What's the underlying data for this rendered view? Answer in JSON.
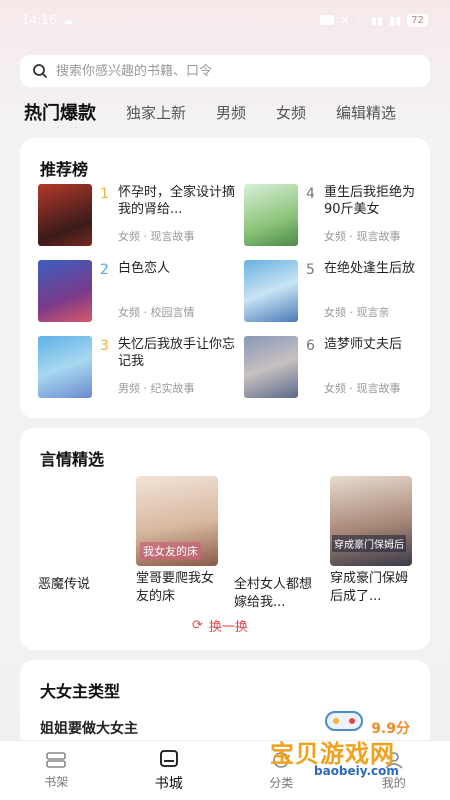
{
  "status": {
    "time": "14:16",
    "battery": "72"
  },
  "search": {
    "placeholder": "搜索你感兴趣的书籍、口令"
  },
  "tabs": [
    {
      "label": "热门爆款",
      "active": true
    },
    {
      "label": "独家上新"
    },
    {
      "label": "男频"
    },
    {
      "label": "女频"
    },
    {
      "label": "编辑精选"
    }
  ],
  "ranking": {
    "title": "推荐榜",
    "items": [
      {
        "num": "1",
        "title": "怀孕时，全家设计摘我的肾给...",
        "meta": "女频 · 现言故事",
        "num_color": "#f3b23a"
      },
      {
        "num": "2",
        "title": "白色恋人",
        "meta": "女频 · 校园言情",
        "num_color": "#5aa7e0"
      },
      {
        "num": "3",
        "title": "失忆后我放手让你忘记我",
        "meta": "男频 · 纪实故事",
        "num_color": "#f3b23a"
      },
      {
        "num": "4",
        "title": "重生后我拒绝为90斤美女",
        "meta": "女频 · 现言故事",
        "num_color": "#777777"
      },
      {
        "num": "5",
        "title": "在绝处逢生后放",
        "meta": "女频 · 现言亲",
        "num_color": "#777777"
      },
      {
        "num": "6",
        "title": "造梦师丈夫后",
        "meta": "女频 · 现言故事",
        "num_color": "#777777"
      }
    ]
  },
  "romance": {
    "title": "言情精选",
    "items": [
      {
        "title": "恶魔传说",
        "has_cover": false
      },
      {
        "title": "堂哥要爬我女友的床",
        "has_cover": true,
        "cover_text": "我女友的床"
      },
      {
        "title": "全村女人都想嫁给我...",
        "has_cover": false
      },
      {
        "title": "穿成豪门保姆后成了...",
        "has_cover": true,
        "cover_text": "穿成豪门保姆后"
      }
    ],
    "refresh_label": "换一换"
  },
  "heroine": {
    "title": "大女主类型",
    "first_item": "姐姐要做大女主",
    "score": "9.9分"
  },
  "nav": [
    {
      "label": "书架",
      "icon": "bookshelf-icon"
    },
    {
      "label": "书城",
      "icon": "bookstore-icon",
      "active": true
    },
    {
      "label": "分类",
      "icon": "category-icon"
    },
    {
      "label": "我的",
      "icon": "profile-icon"
    }
  ],
  "watermark": {
    "title": "宝贝游戏网",
    "url": "baobeiy.com"
  }
}
